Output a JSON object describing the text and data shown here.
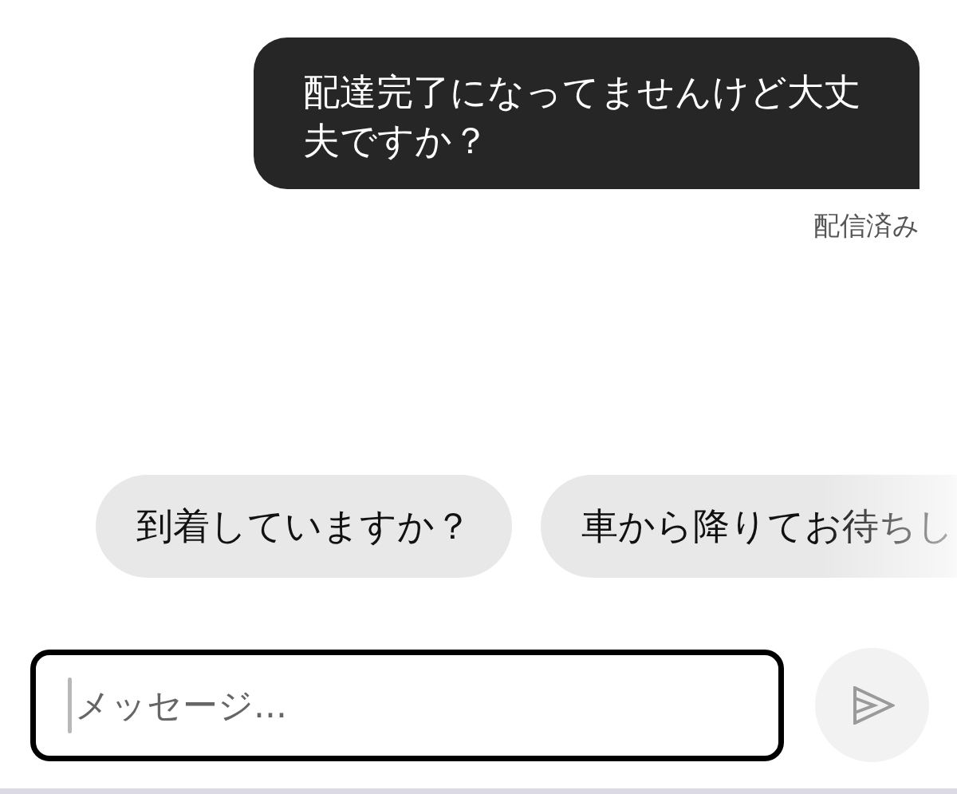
{
  "messages": [
    {
      "text": "配達完了になってませんけど大丈夫ですか？",
      "status": "配信済み"
    }
  ],
  "quick_replies": [
    {
      "label": "到着していますか？"
    },
    {
      "label": "車から降りてお待ちし"
    }
  ],
  "composer": {
    "placeholder": "メッセージ...",
    "focused": true
  },
  "send_button": {
    "disabled": true
  }
}
